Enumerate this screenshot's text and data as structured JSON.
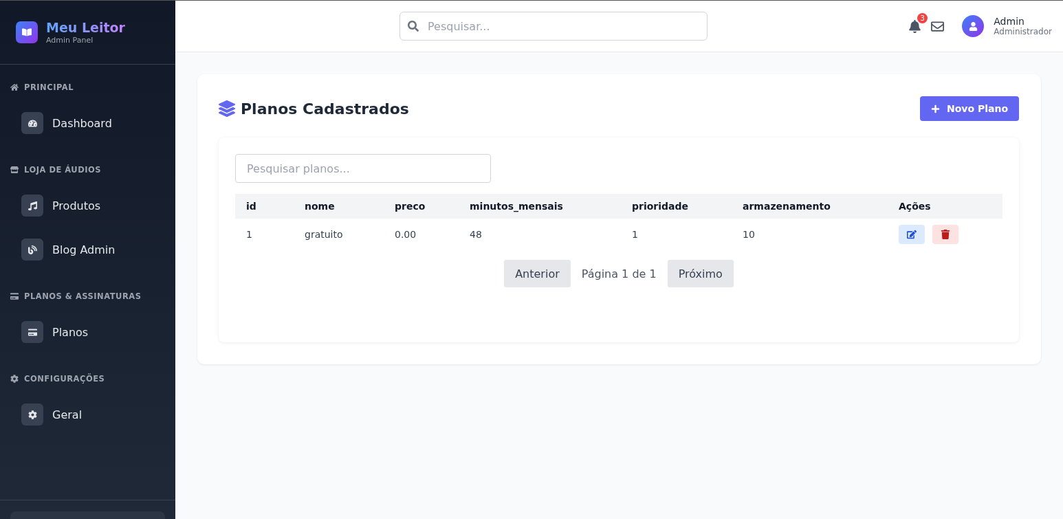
{
  "brand": {
    "title": "Meu Leitor",
    "subtitle": "Admin Panel"
  },
  "sidebar": {
    "sections": [
      {
        "title": "PRINCIPAL",
        "items": [
          {
            "label": "Dashboard"
          }
        ]
      },
      {
        "title": "LOJA DE ÁUDIOS",
        "items": [
          {
            "label": "Produtos"
          },
          {
            "label": "Blog Admin"
          }
        ]
      },
      {
        "title": "PLANOS & ASSINATURAS",
        "items": [
          {
            "label": "Planos"
          }
        ]
      },
      {
        "title": "CONFIGURAÇÕES",
        "items": [
          {
            "label": "Geral"
          }
        ]
      }
    ]
  },
  "header": {
    "search": {
      "placeholder": "Pesquisar..."
    },
    "notifications": "3",
    "user": {
      "name": "Admin",
      "role": "Administrador"
    }
  },
  "page": {
    "title": "Planos Cadastrados",
    "new_button": "Novo Plano",
    "filter": {
      "placeholder": "Pesquisar planos..."
    },
    "table": {
      "columns": [
        "id",
        "nome",
        "preco",
        "minutos_mensais",
        "prioridade",
        "armazenamento",
        "Ações"
      ],
      "rows": [
        {
          "cells": [
            "1",
            "gratuito",
            "0.00",
            "48",
            "1",
            "10"
          ]
        }
      ]
    },
    "pagination": {
      "previous": "Anterior",
      "info": "Página 1 de 1",
      "next": "Próximo"
    }
  }
}
